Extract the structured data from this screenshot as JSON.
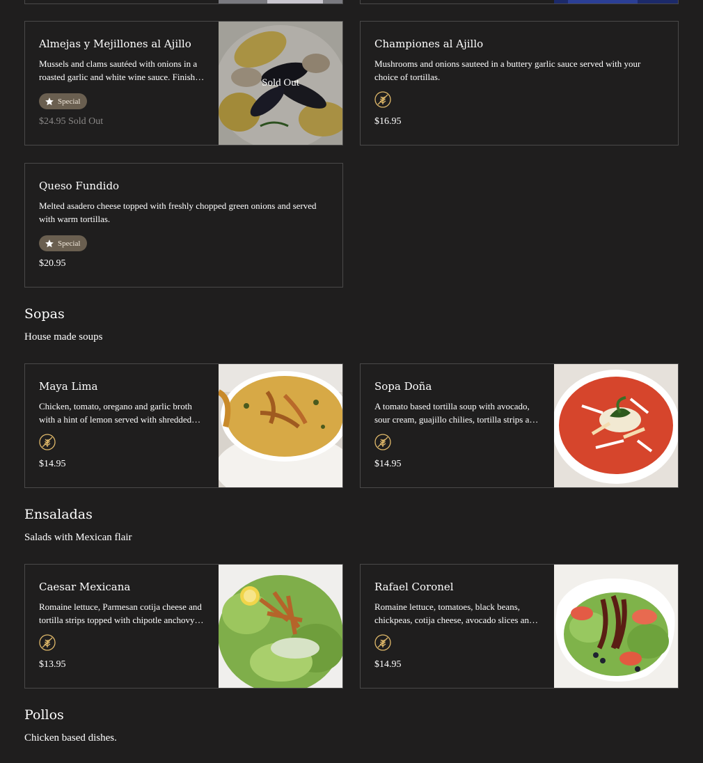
{
  "items": {
    "almejas": {
      "name": "Almejas y Mejillones al Ajillo",
      "description": "Mussels and clams sautéed with onions in a roasted garlic and white wine sauce. Finished with fresh parsley and served with bread.",
      "badge": "Special",
      "price": "$24.95 Sold Out",
      "overlay": "Sold Out"
    },
    "championes": {
      "name": "Championes al Ajillo",
      "description": "Mushrooms and onions sauteed in a buttery garlic sauce served with your choice of tortillas.",
      "diet_icon": "wheat-icon",
      "price": "$16.95"
    },
    "queso": {
      "name": "Queso Fundido",
      "description": "Melted asadero cheese topped with freshly chopped green onions and served with warm tortillas.",
      "badge": "Special",
      "price": "$20.95"
    },
    "maya": {
      "name": "Maya Lima",
      "description": "Chicken, tomato, oregano and garlic broth with a hint of lemon served with shredded chicken and tortilla strips.",
      "diet_icon": "wheat-icon",
      "price": "$14.95"
    },
    "sopa_dona": {
      "name": "Sopa Doña",
      "description": "A tomato based tortilla soup with avocado, sour cream, guajillo chilies, tortilla strips and cheese.",
      "diet_icon": "wheat-icon",
      "price": "$14.95"
    },
    "caesar": {
      "name": "Caesar Mexicana",
      "description": "Romaine lettuce, Parmesan cotija cheese and tortilla strips topped with chipotle anchovy dressing.",
      "diet_icon": "wheat-icon",
      "price": "$13.95"
    },
    "rafael": {
      "name": "Rafael Coronel",
      "description": "Romaine lettuce, tomatoes, black beans, chickpeas, cotija cheese, avocado slices and grilled beef.",
      "diet_icon": "wheat-icon",
      "price": "$14.95"
    }
  },
  "sections": {
    "sopas": {
      "title": "Sopas",
      "subtitle": "House made soups"
    },
    "ensaladas": {
      "title": "Ensaladas",
      "subtitle": "Salads with Mexican flair"
    },
    "pollos": {
      "title": "Pollos",
      "subtitle": "Chicken based dishes."
    }
  },
  "colors": {
    "background": "#1f1e1e",
    "card_border": "#4a4949",
    "badge_bg": "#6a5f50",
    "diet_icon": "#e0b96a"
  }
}
